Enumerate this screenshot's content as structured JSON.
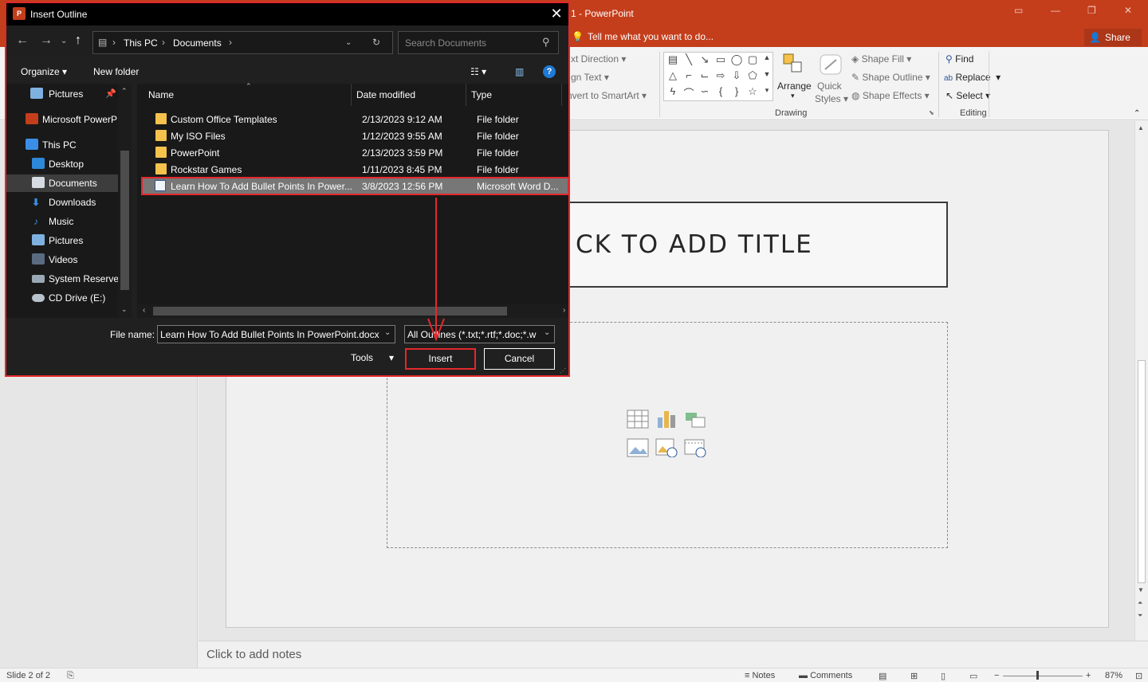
{
  "app": {
    "window_title": "1 - PowerPoint",
    "tell_me": "Tell me what you want to do...",
    "share": "Share"
  },
  "ribbon": {
    "text_direction": "xt Direction",
    "align_text": "gn Text",
    "convert_smartart": "nvert to SmartArt",
    "arrange": "Arrange",
    "quick_styles": [
      "Quick",
      "Styles"
    ],
    "shape_fill": "Shape Fill",
    "shape_outline": "Shape Outline",
    "shape_effects": "Shape Effects",
    "find": "Find",
    "replace": "Replace",
    "select": "Select",
    "groups": {
      "drawing": "Drawing",
      "editing": "Editing"
    }
  },
  "slide": {
    "title_placeholder": "CK TO ADD TITLE",
    "notes_placeholder": "Click to add notes"
  },
  "status": {
    "slide": "Slide 2 of 2",
    "notes": "Notes",
    "comments": "Comments",
    "zoom": "87%"
  },
  "dialog": {
    "title": "Insert Outline",
    "breadcrumb": [
      "This PC",
      "Documents"
    ],
    "search_placeholder": "Search Documents",
    "organize": "Organize",
    "new_folder": "New folder",
    "nav_items": [
      {
        "label": "Pictures",
        "icon": "pictures-icon",
        "pinned": true
      },
      {
        "label": "Microsoft PowerP",
        "icon": "powerpoint-icon"
      },
      {
        "label": "This PC",
        "icon": "computer-icon"
      },
      {
        "label": "Desktop",
        "icon": "desktop-icon"
      },
      {
        "label": "Documents",
        "icon": "documents-icon",
        "selected": true
      },
      {
        "label": "Downloads",
        "icon": "downloads-icon"
      },
      {
        "label": "Music",
        "icon": "music-icon"
      },
      {
        "label": "Pictures",
        "icon": "pictures-icon"
      },
      {
        "label": "Videos",
        "icon": "videos-icon"
      },
      {
        "label": "System Reservec",
        "icon": "drive-icon"
      },
      {
        "label": "CD Drive (E:)",
        "icon": "cd-drive-icon"
      }
    ],
    "columns": [
      "Name",
      "Date modified",
      "Type"
    ],
    "files": [
      {
        "name": "Custom Office Templates",
        "date": "2/13/2023 9:12 AM",
        "type": "File folder",
        "kind": "folder"
      },
      {
        "name": "My ISO Files",
        "date": "1/12/2023 9:55 AM",
        "type": "File folder",
        "kind": "folder"
      },
      {
        "name": "PowerPoint",
        "date": "2/13/2023 3:59 PM",
        "type": "File folder",
        "kind": "folder"
      },
      {
        "name": "Rockstar Games",
        "date": "1/11/2023 8:45 PM",
        "type": "File folder",
        "kind": "folder"
      },
      {
        "name": "Learn How To Add Bullet Points In Power...",
        "date": "3/8/2023 12:56 PM",
        "type": "Microsoft Word D...",
        "kind": "word",
        "selected": true
      }
    ],
    "file_name_label": "File name:",
    "file_name_value": "Learn How To Add Bullet Points In PowerPoint.docx",
    "filter_value": "All Outlines (*.txt;*.rtf;*.doc;*.w",
    "tools": "Tools",
    "insert": "Insert",
    "cancel": "Cancel"
  },
  "colors": {
    "powerpoint_accent": "#c43e1c",
    "highlight_red": "#e3282d",
    "dialog_bg": "#202020"
  }
}
